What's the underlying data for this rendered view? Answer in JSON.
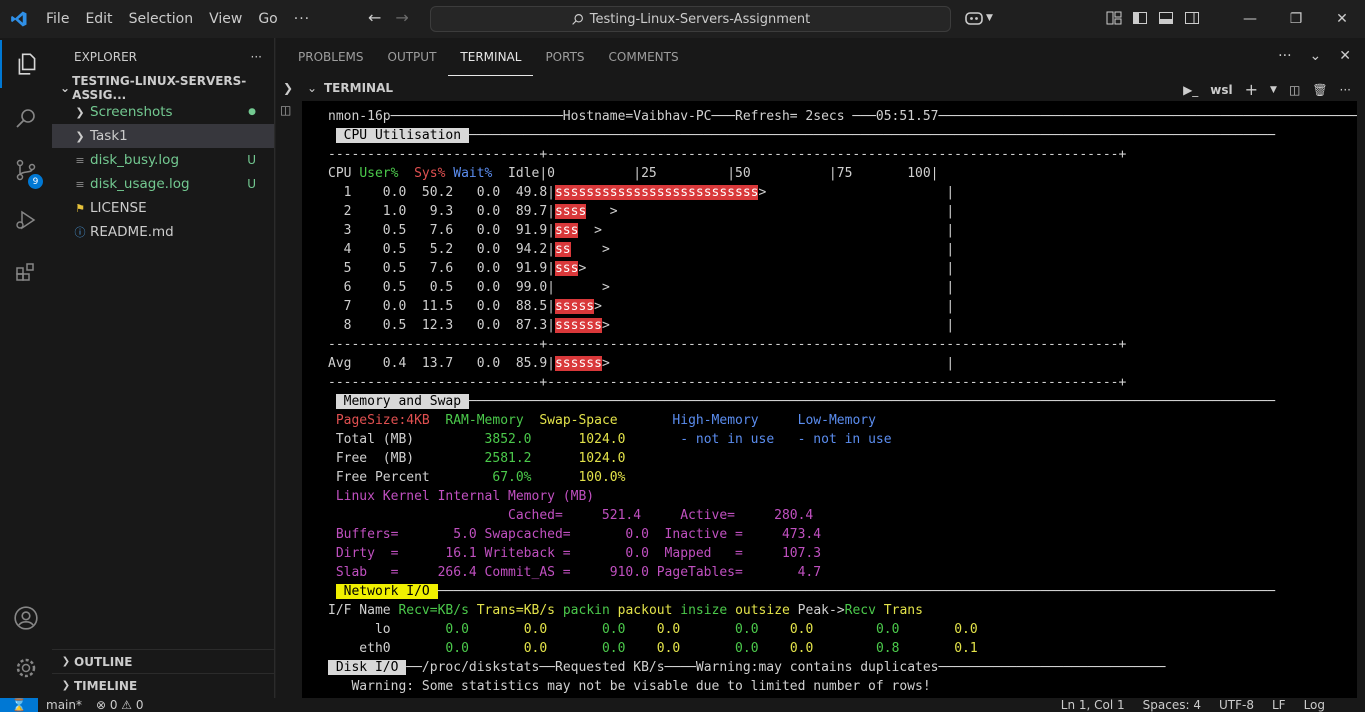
{
  "titlebar": {
    "menu": [
      "File",
      "Edit",
      "Selection",
      "View",
      "Go"
    ],
    "more": "···",
    "search": "Testing-Linux-Servers-Assignment"
  },
  "activity_badge": "9",
  "sidebar": {
    "title": "EXPLORER",
    "more": "···",
    "folder": "TESTING-LINUX-SERVERS-ASSIG...",
    "items": [
      {
        "label": "Screenshots",
        "status": "●",
        "color": "#73c991"
      },
      {
        "label": "Task1",
        "status": "",
        "color": "#cccccc"
      },
      {
        "label": "disk_busy.log",
        "status": "U",
        "color": "#73c991"
      },
      {
        "label": "disk_usage.log",
        "status": "U",
        "color": "#73c991"
      },
      {
        "label": "LICENSE",
        "status": "",
        "color": "#cccccc"
      },
      {
        "label": "README.md",
        "status": "",
        "color": "#cccccc"
      }
    ],
    "outline": "OUTLINE",
    "timeline": "TIMELINE"
  },
  "panel": {
    "tabs": [
      "PROBLEMS",
      "OUTPUT",
      "TERMINAL",
      "PORTS",
      "COMMENTS"
    ],
    "active_tab": "TERMINAL",
    "terminal_title": "TERMINAL",
    "shell": "wsl"
  },
  "terminal": {
    "title_line": "nmon-16p──────────────────────Hostname=Vaibhav-PC───Refresh= 2secs ───05:51.57───────────────────────────────────────────────────────",
    "cpu_header": "CPU Utilisation",
    "cpu_cols": {
      "cpu": "CPU",
      "user": "User%",
      "sys": "Sys%",
      "wait": "Wait%",
      "idle": "Idle",
      "scale": "|0          |25         |50          |75       100|"
    },
    "cpu_rows": [
      {
        "id": "1",
        "user": "0.0",
        "sys": "50.2",
        "wait": "0.0",
        "idle": "49.8",
        "bar": "ssssssssssssssssssssssssss",
        "tail": ">"
      },
      {
        "id": "2",
        "user": "1.0",
        "sys": "9.3",
        "wait": "0.0",
        "idle": "89.7",
        "bar": "ssss",
        "tail": "   >"
      },
      {
        "id": "3",
        "user": "0.5",
        "sys": "7.6",
        "wait": "0.0",
        "idle": "91.9",
        "bar": "sss",
        "tail": "  >"
      },
      {
        "id": "4",
        "user": "0.5",
        "sys": "5.2",
        "wait": "0.0",
        "idle": "94.2",
        "bar": "ss",
        "tail": "    >"
      },
      {
        "id": "5",
        "user": "0.5",
        "sys": "7.6",
        "wait": "0.0",
        "idle": "91.9",
        "bar": "sss",
        "tail": ">"
      },
      {
        "id": "6",
        "user": "0.5",
        "sys": "0.5",
        "wait": "0.0",
        "idle": "99.0",
        "bar": "",
        "tail": "      >"
      },
      {
        "id": "7",
        "user": "0.0",
        "sys": "11.5",
        "wait": "0.0",
        "idle": "88.5",
        "bar": "sssss",
        "tail": ">"
      },
      {
        "id": "8",
        "user": "0.5",
        "sys": "12.3",
        "wait": "0.0",
        "idle": "87.3",
        "bar": "ssssss",
        "tail": ">"
      }
    ],
    "avg": {
      "id": "Avg",
      "user": "0.4",
      "sys": "13.7",
      "wait": "0.0",
      "idle": "85.9",
      "bar": "ssssss",
      "tail": ">"
    },
    "mem_header": "Memory and Swap",
    "mem": {
      "pagesize": "PageSize:4KB",
      "ram": "RAM-Memory",
      "swap": "Swap-Space",
      "high": "High-Memory",
      "low": "Low-Memory",
      "rows": [
        {
          "label": "Total (MB)",
          "ram": "3852.0",
          "swap": "1024.0",
          "high": "- not in use",
          "low": "- not in use"
        },
        {
          "label": "Free  (MB)",
          "ram": "2581.2",
          "swap": "1024.0",
          "high": "",
          "low": ""
        },
        {
          "label": "Free Percent",
          "ram": "67.0%",
          "swap": "100.0%",
          "high": "",
          "low": ""
        }
      ],
      "kernel_title": "Linux Kernel Internal Memory (MB)",
      "kernel_lines": [
        "                      Cached=     521.4     Active=     280.4",
        "Buffers=       5.0 Swapcached=       0.0  Inactive =     473.4",
        "Dirty  =      16.1 Writeback =       0.0  Mapped   =     107.3",
        "Slab   =     266.4 Commit_AS =     910.0 PageTables=       4.7"
      ]
    },
    "net_header": "Network I/O",
    "net_cols": {
      "ifname": "I/F Name",
      "recv": "Recv=KB/s",
      "trans": "Trans=KB/s",
      "packin": "packin",
      "packout": "packout",
      "insize": "insize",
      "outsize": "outsize",
      "peak": "Peak->",
      "precv": "Recv",
      "ptrans": "Trans"
    },
    "net_rows": [
      {
        "name": "lo",
        "recv": "0.0",
        "trans": "0.0",
        "packin": "0.0",
        "packout": "0.0",
        "insize": "0.0",
        "outsize": "0.0",
        "precv": "0.0",
        "ptrans": "0.0"
      },
      {
        "name": "eth0",
        "recv": "0.0",
        "trans": "0.0",
        "packin": "0.0",
        "packout": "0.0",
        "insize": "0.0",
        "outsize": "0.0",
        "precv": "0.8",
        "ptrans": "0.1"
      }
    ],
    "disk_header": "Disk I/O",
    "disk_line": "──/proc/diskstats──Requested KB/s────Warning:may contains duplicates─────────────────────────────",
    "warning": "Warning: Some statistics may not be visable due to limited number of rows!"
  },
  "statusbar": {
    "branch": "main*",
    "problems": "⊗ 0 ⚠ 0",
    "position": "Ln 1, Col 1",
    "spaces": "Spaces: 4",
    "encoding": "UTF-8",
    "eol": "LF",
    "language": "Log"
  }
}
